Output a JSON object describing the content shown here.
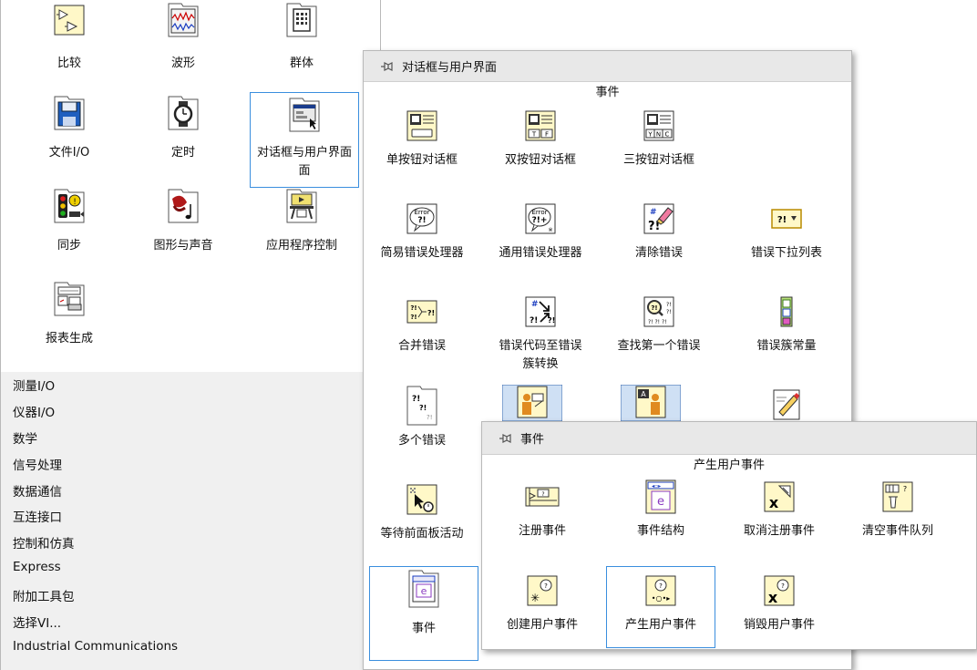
{
  "main_palette": {
    "tiles": [
      {
        "label": "比较",
        "icon": "compare-icon"
      },
      {
        "label": "波形",
        "icon": "waveform-icon"
      },
      {
        "label": "群体",
        "icon": "cluster-icon"
      },
      {
        "label": "文件I/O",
        "icon": "file-io-icon"
      },
      {
        "label": "定时",
        "icon": "timing-icon"
      },
      {
        "label": "对话框与用户界面",
        "label2": "面",
        "icon": "dialog-ui-icon"
      },
      {
        "label": "同步",
        "icon": "sync-icon"
      },
      {
        "label": "图形与声音",
        "icon": "graphics-sound-icon"
      },
      {
        "label": "应用程序控制",
        "icon": "app-control-icon"
      },
      {
        "label": "报表生成",
        "icon": "report-icon"
      }
    ],
    "list_items": [
      "测量I/O",
      "仪器I/O",
      "数学",
      "信号处理",
      "数据通信",
      "互连接口",
      "控制和仿真",
      "Express",
      "附加工具包",
      "选择VI...",
      "Industrial Communications"
    ]
  },
  "dialog_palette": {
    "title": "对话框与用户界面",
    "section": "事件",
    "tiles": [
      {
        "label": "单按钮对话框",
        "icon": "one-button-dialog-icon"
      },
      {
        "label": "双按钮对话框",
        "icon": "two-button-dialog-icon"
      },
      {
        "label": "三按钮对话框",
        "icon": "three-button-dialog-icon"
      },
      {
        "label": "简易错误处理器",
        "icon": "simple-error-handler-icon"
      },
      {
        "label": "通用错误处理器",
        "icon": "general-error-handler-icon"
      },
      {
        "label": "清除错误",
        "icon": "clear-errors-icon"
      },
      {
        "label": "错误下拉列表",
        "icon": "error-ring-icon"
      },
      {
        "label": "合并错误",
        "icon": "merge-errors-icon"
      },
      {
        "label": "错误代码至错误",
        "label2": "簇转换",
        "icon": "error-code-to-cluster-icon"
      },
      {
        "label": "查找第一个错误",
        "icon": "find-first-error-icon"
      },
      {
        "label": "错误簇常量",
        "icon": "error-cluster-constant-icon"
      },
      {
        "label": "多个错误",
        "icon": "multiple-errors-icon"
      },
      {
        "label": "",
        "icon": "user-login-icon"
      },
      {
        "label": "",
        "icon": "user-prompt-icon"
      },
      {
        "label": "",
        "icon": "cursor-edit-icon"
      },
      {
        "label": "等待前面板活动",
        "icon": "wait-front-panel-icon"
      },
      {
        "label": "事件",
        "icon": "events-folder-icon"
      }
    ]
  },
  "events_palette": {
    "title": "事件",
    "section": "产生用户事件",
    "tiles": [
      {
        "label": "注册事件",
        "icon": "register-events-icon"
      },
      {
        "label": "事件结构",
        "icon": "event-structure-icon"
      },
      {
        "label": "取消注册事件",
        "icon": "unregister-events-icon"
      },
      {
        "label": "清空事件队列",
        "icon": "flush-event-queue-icon"
      },
      {
        "label": "创建用户事件",
        "icon": "create-user-event-icon"
      },
      {
        "label": "产生用户事件",
        "icon": "generate-user-event-icon"
      },
      {
        "label": "销毁用户事件",
        "icon": "destroy-user-event-icon"
      }
    ]
  }
}
